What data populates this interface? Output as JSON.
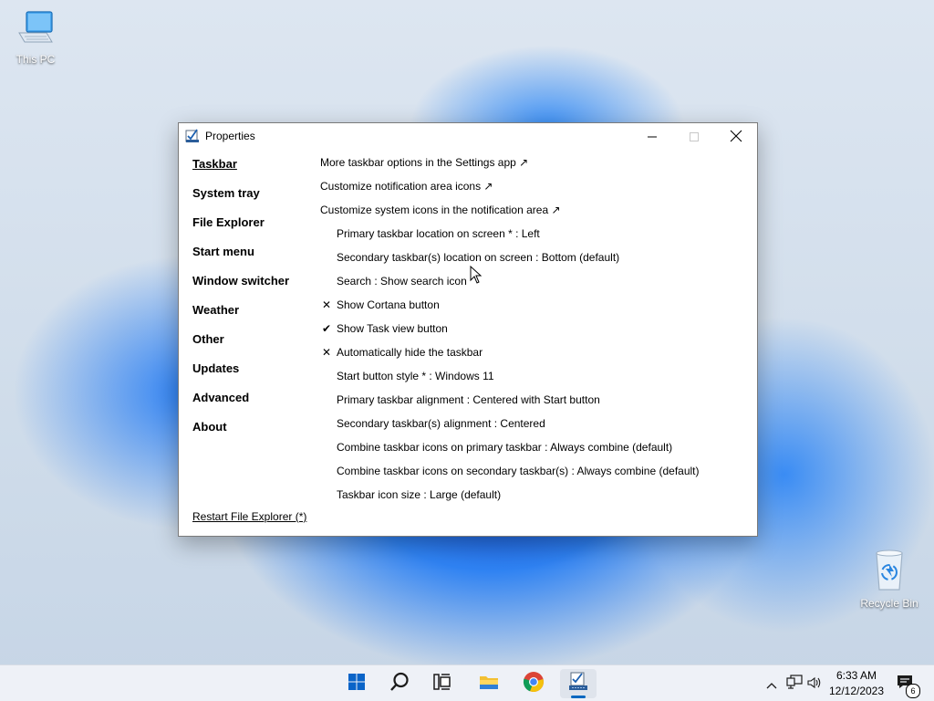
{
  "desktop": {
    "icons": [
      {
        "label": "This PC",
        "icon": "computer-icon"
      },
      {
        "label": "Recycle Bin",
        "icon": "recycle-bin-icon"
      }
    ]
  },
  "window": {
    "title": "Properties",
    "icon": "properties-icon",
    "controls": {
      "minimize": "minimize-icon",
      "maximize": "maximize-icon",
      "close": "close-icon"
    },
    "nav": [
      {
        "label": "Taskbar",
        "active": true
      },
      {
        "label": "System tray"
      },
      {
        "label": "File Explorer"
      },
      {
        "label": "Start menu"
      },
      {
        "label": "Window switcher"
      },
      {
        "label": "Weather"
      },
      {
        "label": "Other"
      },
      {
        "label": "Updates"
      },
      {
        "label": "Advanced"
      },
      {
        "label": "About"
      }
    ],
    "restart_link": "Restart File Explorer (*)",
    "options": [
      {
        "text": "More taskbar options in the Settings app ↗",
        "kind": "link"
      },
      {
        "text": "Customize notification area icons ↗",
        "kind": "link"
      },
      {
        "text": "Customize system icons in the notification area ↗",
        "kind": "link"
      },
      {
        "text": "Primary taskbar location on screen * : Left",
        "kind": "option",
        "mark": ""
      },
      {
        "text": "Secondary taskbar(s) location on screen : Bottom (default)",
        "kind": "option",
        "mark": ""
      },
      {
        "text": "Search : Show search icon",
        "kind": "option",
        "mark": ""
      },
      {
        "text": "Show Cortana button",
        "kind": "option",
        "mark": "✕"
      },
      {
        "text": "Show Task view button",
        "kind": "option",
        "mark": "✔"
      },
      {
        "text": "Automatically hide the taskbar",
        "kind": "option",
        "mark": "✕"
      },
      {
        "text": "Start button style * : Windows 11",
        "kind": "option",
        "mark": ""
      },
      {
        "text": "Primary taskbar alignment : Centered with Start button",
        "kind": "option",
        "mark": ""
      },
      {
        "text": "Secondary taskbar(s) alignment : Centered",
        "kind": "option",
        "mark": ""
      },
      {
        "text": "Combine taskbar icons on primary taskbar : Always combine (default)",
        "kind": "option",
        "mark": ""
      },
      {
        "text": "Combine taskbar icons on secondary taskbar(s) : Always combine (default)",
        "kind": "option",
        "mark": ""
      },
      {
        "text": "Taskbar icon size : Large (default)",
        "kind": "option",
        "mark": ""
      }
    ]
  },
  "taskbar": {
    "buttons": [
      {
        "name": "start-button",
        "icon": "windows-logo-icon"
      },
      {
        "name": "search-button",
        "icon": "search-icon"
      },
      {
        "name": "task-view-button",
        "icon": "task-view-icon"
      },
      {
        "name": "file-explorer-button",
        "icon": "folder-icon"
      },
      {
        "name": "chrome-button",
        "icon": "chrome-icon"
      },
      {
        "name": "properties-app-button",
        "icon": "properties-icon",
        "active": true
      }
    ],
    "tray": {
      "icons": [
        "chevron-up-icon",
        "network-icon",
        "volume-icon"
      ],
      "time": "6:33 AM",
      "date": "12/12/2023",
      "notification_count": "6"
    }
  },
  "colors": {
    "accent": "#0067c0",
    "window_bg": "#ffffff",
    "taskbar_bg": "#eef1f7"
  }
}
